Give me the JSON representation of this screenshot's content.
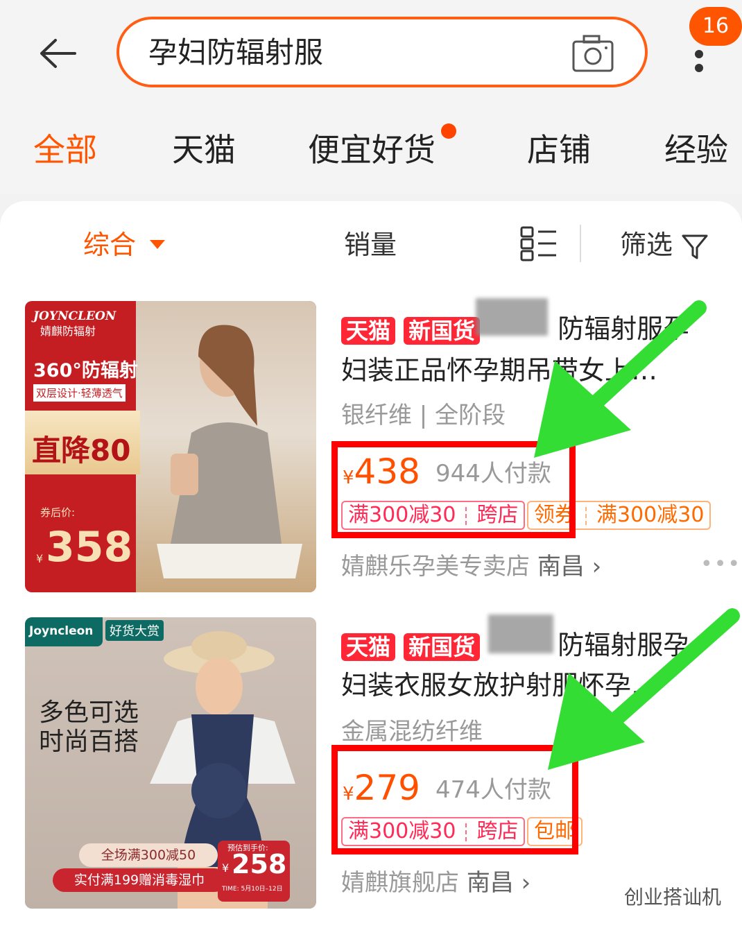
{
  "search": {
    "query": "孕妇防辐射服"
  },
  "notification_count": "16",
  "tabs": [
    {
      "label": "全部"
    },
    {
      "label": "天猫"
    },
    {
      "label": "便宜好货"
    },
    {
      "label": "店铺"
    },
    {
      "label": "经验"
    }
  ],
  "sort": {
    "comprehensive": "综合",
    "sales": "销量",
    "filter": "筛选"
  },
  "products": [
    {
      "thumb_brand": "JOYNCLEON",
      "thumb_brand_cn": "婧麒防辐射",
      "thumb_headline": "360°防辐射",
      "thumb_sub": "双层设计·轻薄透气",
      "thumb_promo": "直降80",
      "thumb_after_coupon": "券后价:",
      "thumb_price_yen": "¥",
      "thumb_price": "358",
      "tag_tmall": "天猫",
      "tag_guohuo": "新国货",
      "title_line1": "防辐射服孕",
      "title_line2": "妇装正品怀孕期吊带女上…",
      "attrs": "银纤维 | 全阶段",
      "price_symbol": "¥",
      "price": "438",
      "sales": "944人付款",
      "coupon1_a": "满300减30",
      "coupon1_b": "跨店",
      "coupon2_a": "领券",
      "coupon2_b": "满300减30",
      "shop": "婧麒乐孕美专卖店",
      "city": "南昌",
      "more": "•••"
    },
    {
      "thumb_brand": "Joyncleon",
      "thumb_badge": "好货大赏",
      "thumb_line1": "多色可选",
      "thumb_line2": "时尚百搭",
      "thumb_promo1": "全场满300减50",
      "thumb_promo2": "实付满199赠消毒湿巾",
      "thumb_presale": "预估到手价:",
      "thumb_price_yen": "¥",
      "thumb_price": "258",
      "thumb_time": "TIME: 5月10日–12日",
      "tag_tmall": "天猫",
      "tag_guohuo": "新国货",
      "title_line1": "防辐射服孕",
      "title_line2": "妇装衣服女放护射服怀孕…",
      "attrs": "金属混纺纤维",
      "price_symbol": "¥",
      "price": "279",
      "sales": "474人付款",
      "coupon1_a": "满300减30",
      "coupon1_b": "跨店",
      "coupon2_a": "包邮",
      "shop": "婧麒旗舰店",
      "city": "南昌"
    }
  ],
  "watermark": "创业搭讪机",
  "colors": {
    "accent": "#ff5500",
    "tag_red": "#ff2636",
    "annotation_red": "#ff0000",
    "annotation_green": "#33dd33"
  }
}
